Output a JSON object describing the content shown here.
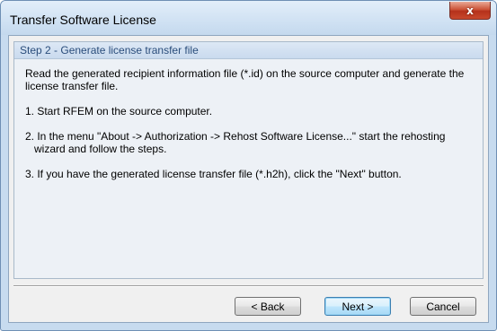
{
  "window": {
    "title": "Transfer Software License",
    "close_glyph": "x"
  },
  "step": {
    "header": "Step 2 - Generate license transfer file",
    "intro": "Read the generated recipient information file (*.id) on the source computer and generate the license transfer file.",
    "items": [
      "1. Start RFEM on the source computer.",
      "2. In the menu \"About -> Authorization -> Rehost Software License...\" start the rehosting wizard and follow the steps.",
      "3. If you have the generated license transfer file (*.h2h), click the \"Next\" button."
    ]
  },
  "buttons": {
    "back": "< Back",
    "next": "Next >",
    "cancel": "Cancel"
  },
  "colors": {
    "frame": "#c7dbef",
    "header_text": "#2a4d7b",
    "close_button": "#c8482c",
    "default_button": "#bee6fd"
  }
}
